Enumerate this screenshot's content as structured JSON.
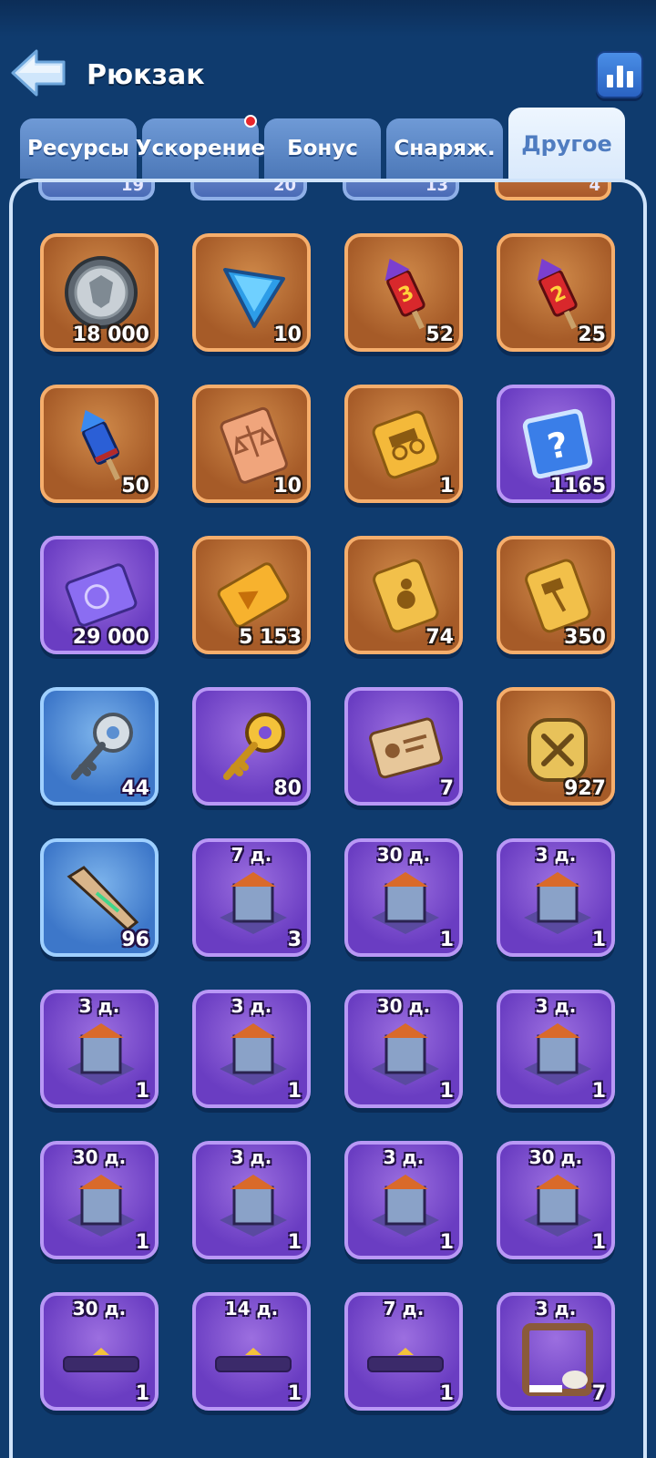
{
  "header": {
    "title": "Рюкзак",
    "back_icon": "back-arrow-icon",
    "stats_icon": "bar-chart-icon"
  },
  "tabs": [
    {
      "label": "Ресурсы",
      "active": false,
      "notification": false
    },
    {
      "label": "Ускорение",
      "active": false,
      "notification": true
    },
    {
      "label": "Бонус",
      "active": false,
      "notification": false
    },
    {
      "label": "Снаряж.",
      "active": false,
      "notification": false
    },
    {
      "label": "Другое",
      "active": true,
      "notification": false
    }
  ],
  "partial_row": [
    "19",
    "20",
    "13",
    "4"
  ],
  "items": [
    {
      "icon": "silver-coin-icon",
      "rarity": "orange",
      "count": "18 000",
      "duration": ""
    },
    {
      "icon": "blue-crystal-icon",
      "rarity": "orange",
      "count": "10",
      "duration": ""
    },
    {
      "icon": "firework-rocket-3-icon",
      "rarity": "orange",
      "count": "52",
      "duration": ""
    },
    {
      "icon": "firework-rocket-2-icon",
      "rarity": "orange",
      "count": "25",
      "duration": ""
    },
    {
      "icon": "firework-rocket-icon",
      "rarity": "orange",
      "count": "50",
      "duration": ""
    },
    {
      "icon": "scales-ticket-icon",
      "rarity": "orange",
      "count": "10",
      "duration": ""
    },
    {
      "icon": "gold-ticket-icon",
      "rarity": "orange",
      "count": "1",
      "duration": ""
    },
    {
      "icon": "mystery-box-icon",
      "rarity": "purple",
      "count": "1165",
      "duration": ""
    },
    {
      "icon": "purple-ticket-icon",
      "rarity": "purple",
      "count": "29 000",
      "duration": ""
    },
    {
      "icon": "gold-plane-ticket-icon",
      "rarity": "orange",
      "count": "5 153",
      "duration": ""
    },
    {
      "icon": "gold-card-icon",
      "rarity": "orange",
      "count": "74",
      "duration": ""
    },
    {
      "icon": "gold-hammer-card-icon",
      "rarity": "orange",
      "count": "350",
      "duration": ""
    },
    {
      "icon": "silver-key-icon",
      "rarity": "blue",
      "count": "44",
      "duration": ""
    },
    {
      "icon": "gold-key-icon",
      "rarity": "purple",
      "count": "80",
      "duration": ""
    },
    {
      "icon": "id-card-tag-icon",
      "rarity": "purple",
      "count": "7",
      "duration": ""
    },
    {
      "icon": "gold-badge-icon",
      "rarity": "orange",
      "count": "927",
      "duration": ""
    },
    {
      "icon": "spear-tip-icon",
      "rarity": "blue",
      "count": "96",
      "duration": ""
    },
    {
      "icon": "dark-castle-icon",
      "rarity": "purple",
      "count": "3",
      "duration": "7 д."
    },
    {
      "icon": "snow-globe-icon",
      "rarity": "purple",
      "count": "1",
      "duration": "30 д."
    },
    {
      "icon": "ice-castle-icon",
      "rarity": "purple",
      "count": "1",
      "duration": "3 д."
    },
    {
      "icon": "fire-forge-icon",
      "rarity": "purple",
      "count": "1",
      "duration": "3 д."
    },
    {
      "icon": "pumpkin-house-icon",
      "rarity": "purple",
      "count": "1",
      "duration": "3 д."
    },
    {
      "icon": "fish-house-icon",
      "rarity": "purple",
      "count": "1",
      "duration": "30 д."
    },
    {
      "icon": "gift-fountain-icon",
      "rarity": "purple",
      "count": "1",
      "duration": "3 д."
    },
    {
      "icon": "dragon-ice-icon",
      "rarity": "purple",
      "count": "1",
      "duration": "30 д."
    },
    {
      "icon": "snow-castle-icon",
      "rarity": "purple",
      "count": "1",
      "duration": "3 д."
    },
    {
      "icon": "garden-house-icon",
      "rarity": "purple",
      "count": "1",
      "duration": "3 д."
    },
    {
      "icon": "whale-icon",
      "rarity": "purple",
      "count": "1",
      "duration": "30 д."
    },
    {
      "icon": "nameplate-icon",
      "rarity": "purple",
      "count": "1",
      "duration": "30 д."
    },
    {
      "icon": "nameplate-icon",
      "rarity": "purple",
      "count": "1",
      "duration": "14 д."
    },
    {
      "icon": "nameplate-icon",
      "rarity": "purple",
      "count": "1",
      "duration": "7 д."
    },
    {
      "icon": "skull-frame-icon",
      "rarity": "purple",
      "count": "7",
      "duration": "3 д."
    }
  ]
}
